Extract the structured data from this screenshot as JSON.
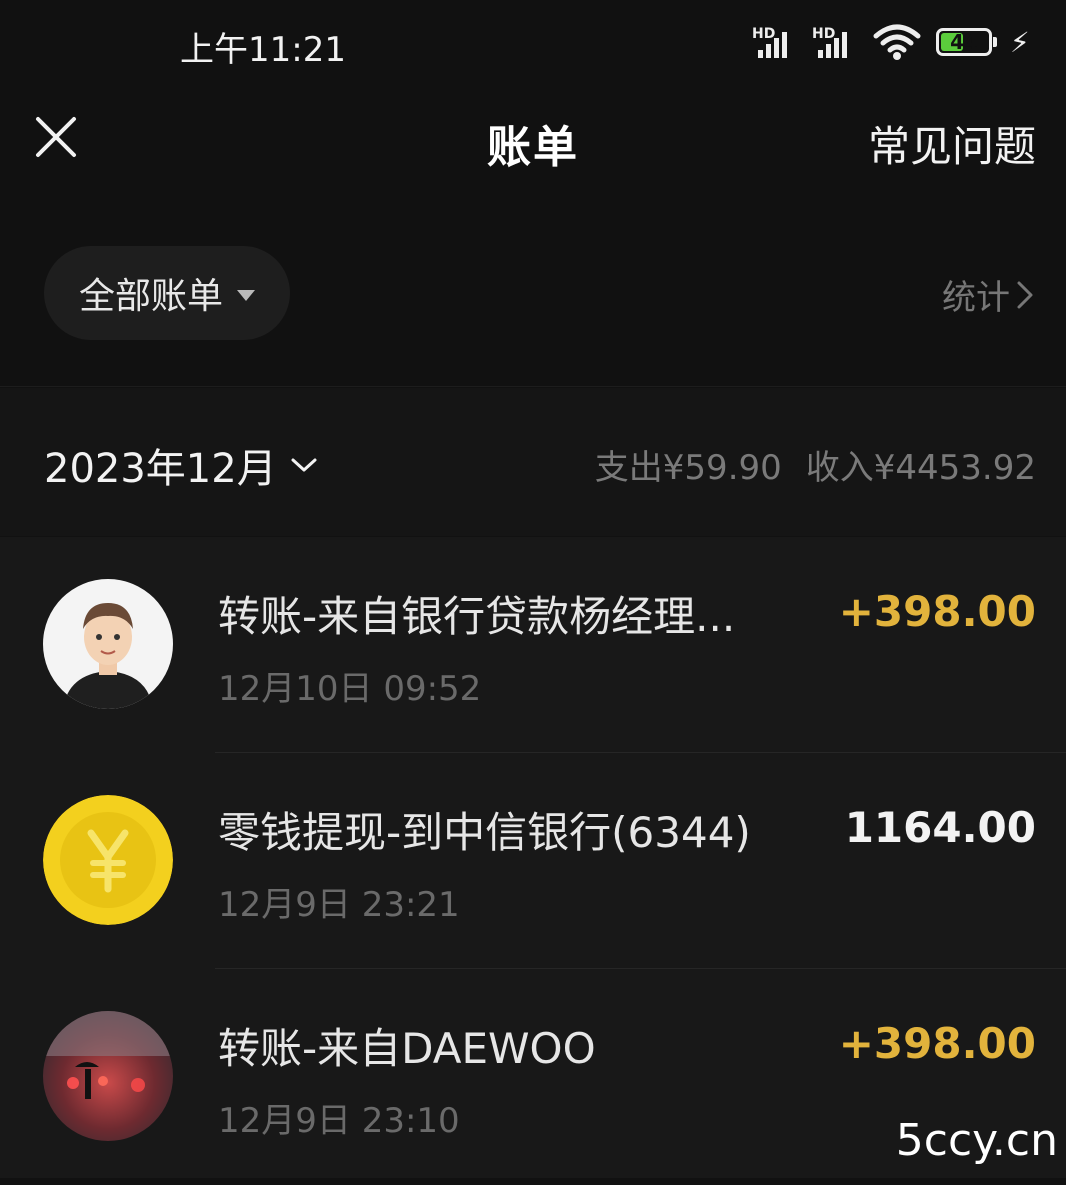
{
  "status_bar": {
    "time": "上午11:21",
    "signal_1_label": "HD",
    "signal_2_label": "HD",
    "battery_level": "44",
    "icons": [
      "signal-icon",
      "signal-icon",
      "wifi-icon",
      "battery-icon",
      "charging-icon"
    ]
  },
  "nav": {
    "close_icon": "close-icon",
    "title": "账单",
    "faq_label": "常见问题"
  },
  "filter": {
    "label": "全部账单",
    "stats_label": "统计"
  },
  "month_summary": {
    "month": "2023年12月",
    "expense": "支出¥59.90",
    "income": "收入¥4453.92"
  },
  "transactions": [
    {
      "title": "转账-来自银行贷款杨经理...",
      "datetime": "12月10日 09:52",
      "amount": "+398.00",
      "amount_color": "#e2b33c",
      "avatar": "cartoon-man-avatar"
    },
    {
      "title": "零钱提现-到中信银行(6344)",
      "datetime": "12月9日 23:21",
      "amount": "1164.00",
      "amount_color": "#f2f2f2",
      "avatar": "yuan-coin-icon"
    },
    {
      "title": "转账-来自DAEWOO",
      "datetime": "12月9日 23:10",
      "amount": "+398.00",
      "amount_color": "#e2b33c",
      "avatar": "rainy-street-photo-avatar"
    }
  ],
  "watermark": "5ccy.cn",
  "colors": {
    "background": "#111111",
    "accent_gold": "#e2b33c",
    "coin_yellow": "#f3d01e"
  }
}
